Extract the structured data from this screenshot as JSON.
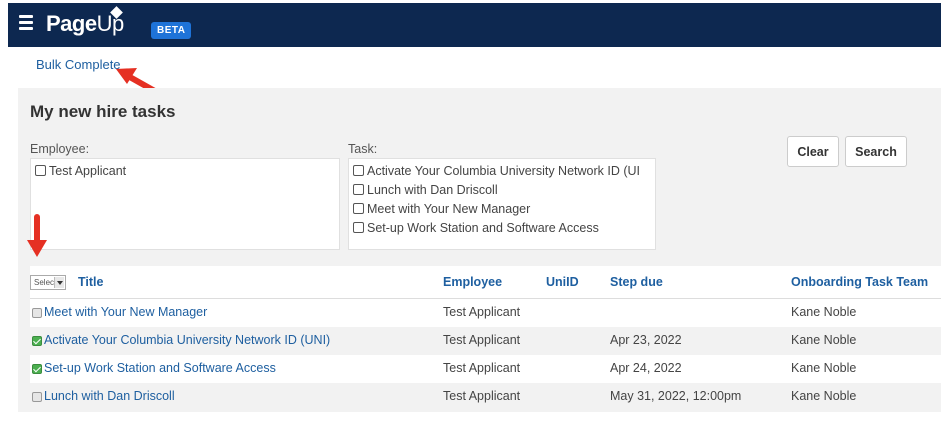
{
  "header": {
    "brand_page": "Page",
    "brand_up": "Up",
    "beta_label": "BETA",
    "bg_color": "#0d2850"
  },
  "bulk_complete_label": "Bulk Complete",
  "panel": {
    "title": "My new hire tasks",
    "employee_label": "Employee:",
    "employee_options": [
      "Test Applicant"
    ],
    "task_label": "Task:",
    "task_options": [
      "Activate Your Columbia University Network ID (UI",
      "Lunch with Dan Driscoll",
      "Meet with Your New Manager",
      "Set-up Work Station and Software Access"
    ],
    "clear_label": "Clear",
    "search_label": "Search"
  },
  "table": {
    "select_label": "Select",
    "columns": [
      "Title",
      "Employee",
      "UniID",
      "Step due",
      "Onboarding Task Team"
    ],
    "rows": [
      {
        "title": "Meet with Your New Manager",
        "employee": "Test Applicant",
        "uniid": "",
        "step_due": "",
        "team": "Kane Noble",
        "checked": false
      },
      {
        "title": "Activate Your Columbia University Network ID (UNI)",
        "employee": "Test Applicant",
        "uniid": "",
        "step_due": "Apr 23, 2022",
        "team": "Kane Noble",
        "checked": true
      },
      {
        "title": "Set-up Work Station and Software Access",
        "employee": "Test Applicant",
        "uniid": "",
        "step_due": "Apr 24, 2022",
        "team": "Kane Noble",
        "checked": true
      },
      {
        "title": "Lunch with Dan Driscoll",
        "employee": "Test Applicant",
        "uniid": "",
        "step_due": "May 31, 2022, 12:00pm",
        "team": "Kane Noble",
        "checked": false
      }
    ]
  },
  "colors": {
    "link": "#1e5fa0",
    "annotation_arrow": "#e53023",
    "checked_box": "#4caf50"
  }
}
